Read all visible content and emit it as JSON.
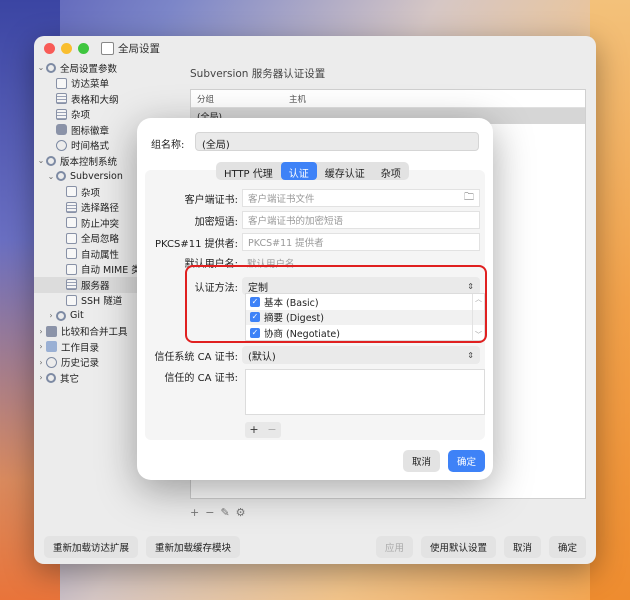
{
  "window": {
    "title": "全局设置"
  },
  "sidebar": {
    "items": [
      {
        "label": "全局设置参数",
        "level": 0,
        "chev": "⌄",
        "icon": "gear"
      },
      {
        "label": "访达菜单",
        "level": 1,
        "chev": "",
        "icon": "doc"
      },
      {
        "label": "表格和大纲",
        "level": 1,
        "chev": "",
        "icon": "grid"
      },
      {
        "label": "杂项",
        "level": 1,
        "chev": "",
        "icon": "grid"
      },
      {
        "label": "图标徽章",
        "level": 1,
        "chev": "",
        "icon": "badge"
      },
      {
        "label": "时间格式",
        "level": 1,
        "chev": "",
        "icon": "clock"
      },
      {
        "label": "版本控制系统",
        "level": 0,
        "chev": "⌄",
        "icon": "gear"
      },
      {
        "label": "Subversion",
        "level": 1,
        "chev": "⌄",
        "icon": "gear"
      },
      {
        "label": "杂项",
        "level": 2,
        "chev": "",
        "icon": "doc"
      },
      {
        "label": "选择路径",
        "level": 2,
        "chev": "",
        "icon": "grid"
      },
      {
        "label": "防止冲突",
        "level": 2,
        "chev": "",
        "icon": "doc"
      },
      {
        "label": "全局忽略",
        "level": 2,
        "chev": "",
        "icon": "doc"
      },
      {
        "label": "自动属性",
        "level": 2,
        "chev": "",
        "icon": "doc"
      },
      {
        "label": "自动 MIME 类型",
        "level": 2,
        "chev": "",
        "icon": "doc"
      },
      {
        "label": "服务器",
        "level": 2,
        "chev": "",
        "icon": "grid",
        "selected": true
      },
      {
        "label": "SSH 隧道",
        "level": 2,
        "chev": "",
        "icon": "doc"
      },
      {
        "label": "Git",
        "level": 1,
        "chev": "›",
        "icon": "gear"
      },
      {
        "label": "比较和合并工具",
        "level": 0,
        "chev": "›",
        "icon": "bolt"
      },
      {
        "label": "工作目录",
        "level": 0,
        "chev": "›",
        "icon": "folder"
      },
      {
        "label": "历史记录",
        "level": 0,
        "chev": "›",
        "icon": "clock"
      },
      {
        "label": "其它",
        "level": 0,
        "chev": "›",
        "icon": "gear"
      }
    ]
  },
  "content": {
    "title": "Subversion 服务器认证设置",
    "table": {
      "columns": [
        "分组",
        "主机"
      ],
      "rows": [
        "(全局)"
      ]
    },
    "toolbar": {
      "add": "+",
      "remove": "−"
    }
  },
  "bottom_bar": {
    "reload_finder": "重新加载访达扩展",
    "reload_cache": "重新加载缓存模块",
    "apply": "应用",
    "use_default": "使用默认设置",
    "cancel": "取消",
    "ok": "确定"
  },
  "dialog": {
    "group_name_label": "组名称:",
    "group_name_value": "(全局)",
    "tabs": [
      "HTTP 代理",
      "认证",
      "缓存认证",
      "杂项"
    ],
    "active_tab": "认证",
    "client_cert_label": "客户端证书:",
    "client_cert_placeholder": "客户端证书文件",
    "passphrase_label": "加密短语:",
    "passphrase_placeholder": "客户端证书的加密短语",
    "pkcs_label": "PKCS#11 提供者:",
    "pkcs_placeholder": "PKCS#11 提供者",
    "default_user_label": "默认用户名:",
    "default_user_placeholder": "默认用户名",
    "auth_method_label": "认证方法:",
    "auth_method_value": "定制",
    "auth_options": [
      "基本 (Basic)",
      "摘要 (Digest)",
      "协商 (Negotiate)"
    ],
    "trust_system_ca_label": "信任系统 CA 证书:",
    "trust_system_ca_value": "(默认)",
    "trusted_ca_label": "信任的 CA 证书:",
    "plus": "+",
    "minus": "−",
    "cancel": "取消",
    "ok": "确定"
  }
}
